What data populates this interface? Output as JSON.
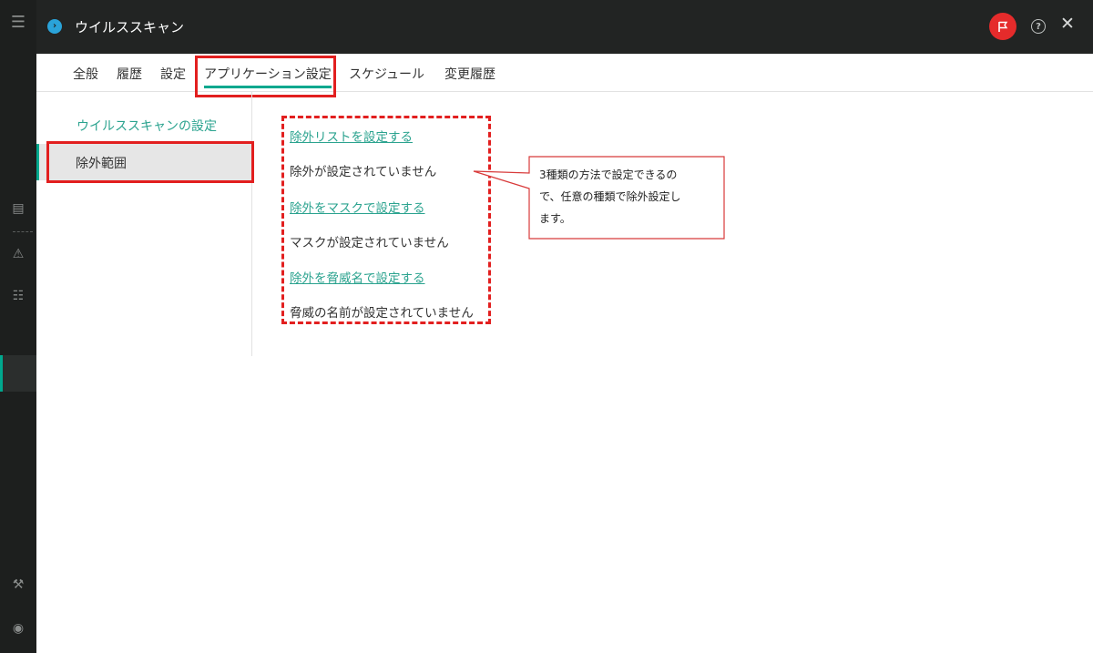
{
  "window": {
    "title": "ウイルススキャン"
  },
  "tabs": [
    "全般",
    "履歴",
    "設定",
    "アプリケーション設定",
    "スケジュール",
    "変更履歴"
  ],
  "sidebar": {
    "heading": "ウイルススキャンの設定",
    "active_item": "除外範囲"
  },
  "content": {
    "list_link": "除外リストを設定する",
    "list_status": "除外が設定されていません",
    "mask_link": "除外をマスクで設定する",
    "mask_status": "マスクが設定されていません",
    "threat_link": "除外を脅威名で設定する",
    "threat_status": "脅威の名前が設定されていません"
  },
  "callout": {
    "line1": "3種類の方法で設定できるの",
    "line2": "で、任意の種類で除外設定し",
    "line3": "ます。"
  },
  "icons": {
    "menu": "menu-icon",
    "logo": "app-logo-icon",
    "flag": "flag-icon",
    "help": "help-icon",
    "close": "close-icon",
    "settings": "wrench-icon",
    "account": "account-icon"
  },
  "colors": {
    "accent": "#00a88e",
    "link": "#2ba38f",
    "highlight": "#e21f1f",
    "titlebar": "#222423",
    "rail": "#1d1f1e",
    "flag_bg": "#e52b2b"
  }
}
